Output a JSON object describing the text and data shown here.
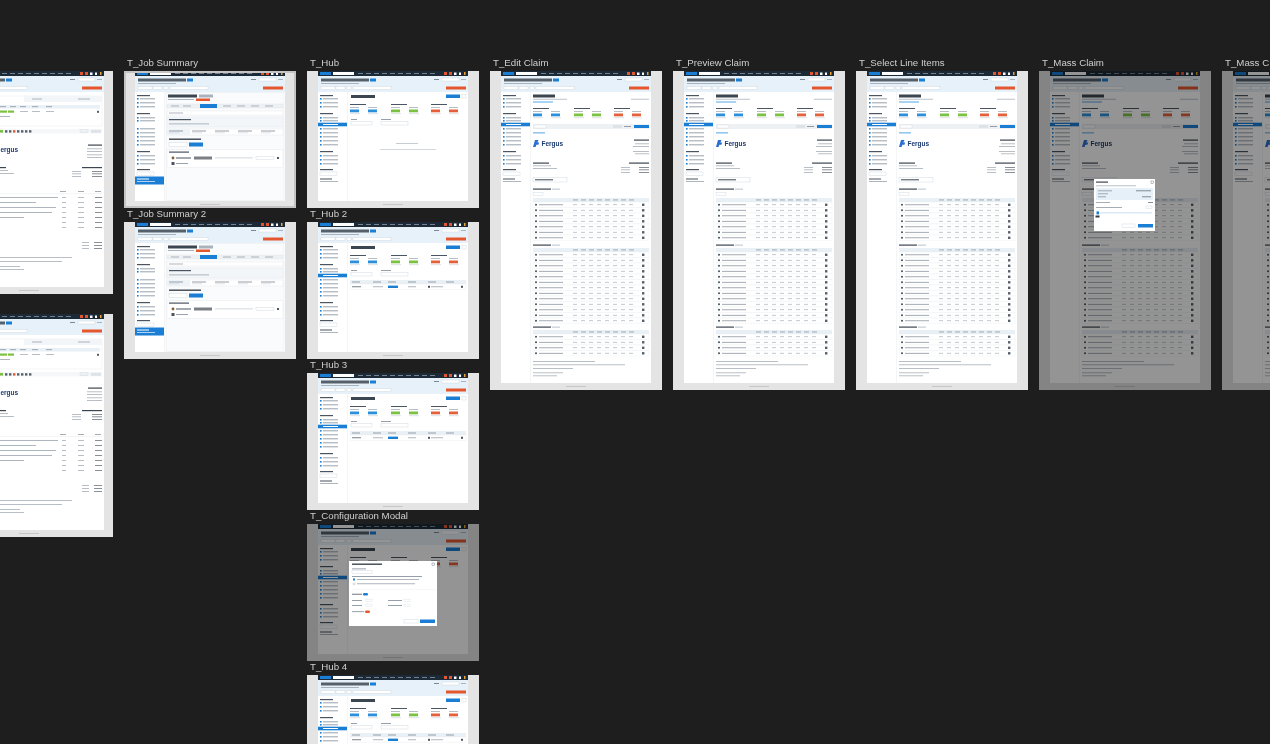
{
  "canvas": {
    "columns": [
      {
        "frames": [
          {
            "kind": "invoice",
            "logo_text": "ergus",
            "selected": false,
            "overlay": false
          },
          {
            "kind": "invoice",
            "logo_text": "ergus",
            "selected": false,
            "overlay": false
          }
        ]
      },
      {
        "frames": [
          {
            "title": "T_Job Summary",
            "kind": "summary",
            "selected": true,
            "overlay": false
          },
          {
            "title": "T_Job Summary 2",
            "kind": "summary",
            "selected": false,
            "overlay": false
          }
        ]
      },
      {
        "frames": [
          {
            "title": "T_Hub",
            "kind": "hub",
            "selected": false,
            "overlay": false
          },
          {
            "title": "T_Hub 2",
            "kind": "hub_list",
            "selected": false,
            "overlay": false
          },
          {
            "title": "T_Hub 3",
            "kind": "hub_list",
            "selected": false,
            "overlay": false
          },
          {
            "title": "T_Configuration Modal",
            "kind": "hub",
            "selected": false,
            "overlay": true
          },
          {
            "title": "T_Hub 4",
            "kind": "hub_list",
            "selected": false,
            "overlay": false
          }
        ]
      },
      {
        "frames": [
          {
            "title": "T_Edit Claim",
            "kind": "document",
            "logo_text": "Fergus",
            "selected": false,
            "overlay": false
          }
        ]
      },
      {
        "frames": [
          {
            "title": "T_Preview Claim",
            "kind": "document",
            "logo_text": "Fergus",
            "selected": false,
            "overlay": false
          }
        ]
      },
      {
        "frames": [
          {
            "title": "T_Select Line Items",
            "kind": "document",
            "logo_text": "Fergus",
            "selected": false,
            "overlay": false
          }
        ]
      },
      {
        "frames": [
          {
            "title": "T_Mass Claim",
            "kind": "document",
            "logo_text": "Fergus",
            "selected": false,
            "overlay": true
          }
        ]
      },
      {
        "frames": [
          {
            "title": "T_Mass C",
            "kind": "document",
            "selected": false,
            "overlay": true
          }
        ]
      }
    ]
  }
}
